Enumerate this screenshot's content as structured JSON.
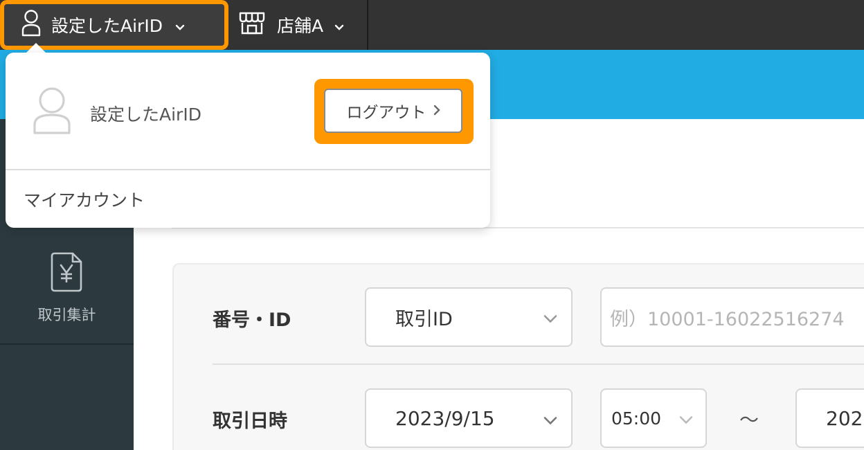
{
  "topbar": {
    "account_label": "設定したAirID",
    "store_label": "店舗A"
  },
  "dropdown": {
    "username": "設定したAirID",
    "logout_label": "ログアウト",
    "my_account_label": "マイアカウント"
  },
  "sidebar": {
    "items": [
      {
        "label": "取引集計",
        "icon": "yen-document-icon"
      }
    ]
  },
  "search_form": {
    "id_row": {
      "label": "番号・ID",
      "select_value": "取引ID",
      "input_placeholder": "例）10001-16022516274"
    },
    "date_row": {
      "label": "取引日時",
      "start_date": "2023/9/15",
      "start_time": "05:00",
      "range_separator": "〜",
      "end_date_partial": "202"
    }
  },
  "colors": {
    "topbar": "#333333",
    "highlight": "#ff9800",
    "brand_blue": "#21ace3",
    "sidebar": "#2c3a3f"
  }
}
